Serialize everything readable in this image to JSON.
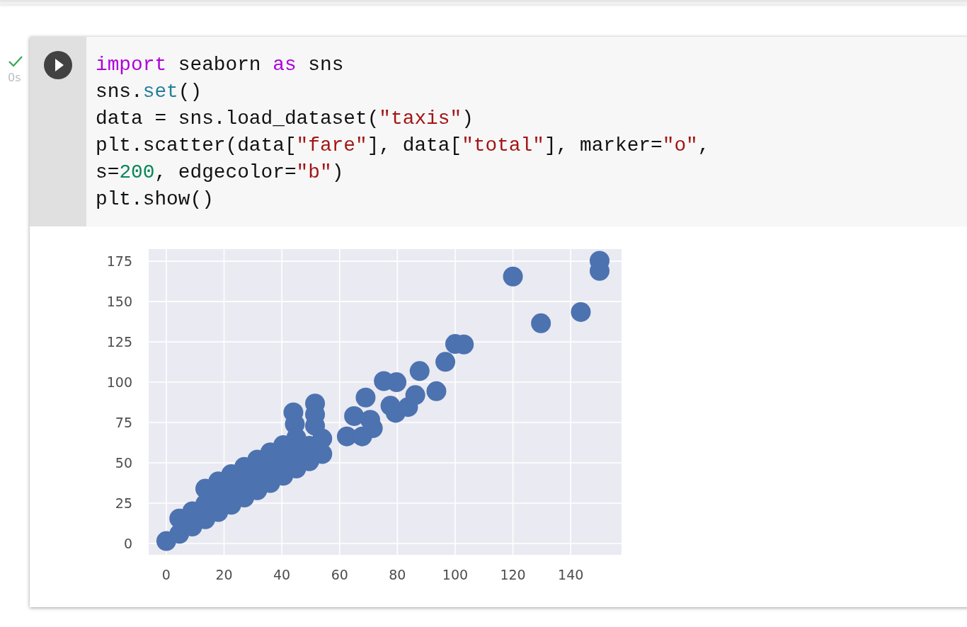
{
  "cell": {
    "executed": true,
    "duration": "0s",
    "code_lines": [
      {
        "tokens": [
          {
            "kind": "keyword",
            "text": "import"
          },
          {
            "kind": "plain",
            "text": " seaborn "
          },
          {
            "kind": "keyword",
            "text": "as"
          },
          {
            "kind": "plain",
            "text": " sns"
          }
        ]
      },
      {
        "tokens": [
          {
            "kind": "plain",
            "text": "sns."
          },
          {
            "kind": "function",
            "text": "set"
          },
          {
            "kind": "plain",
            "text": "()"
          }
        ]
      },
      {
        "tokens": [
          {
            "kind": "plain",
            "text": "data = sns.load_dataset("
          },
          {
            "kind": "string",
            "text": "\"taxis\""
          },
          {
            "kind": "plain",
            "text": ")"
          }
        ]
      },
      {
        "tokens": [
          {
            "kind": "plain",
            "text": "plt.scatter(data["
          },
          {
            "kind": "string",
            "text": "\"fare\""
          },
          {
            "kind": "plain",
            "text": "], data["
          },
          {
            "kind": "string",
            "text": "\"total\""
          },
          {
            "kind": "plain",
            "text": "], marker="
          },
          {
            "kind": "string",
            "text": "\"o\""
          },
          {
            "kind": "plain",
            "text": ","
          }
        ]
      },
      {
        "tokens": [
          {
            "kind": "plain",
            "text": "s="
          },
          {
            "kind": "number",
            "text": "200"
          },
          {
            "kind": "plain",
            "text": ", edgecolor="
          },
          {
            "kind": "string",
            "text": "\"b\""
          },
          {
            "kind": "plain",
            "text": ")"
          }
        ]
      },
      {
        "tokens": [
          {
            "kind": "plain",
            "text": "plt.show()"
          }
        ]
      }
    ],
    "output": {
      "chart_data": {
        "type": "scatter",
        "marker": "o",
        "grid": true,
        "color": "#4c72b0",
        "x": [
          62.5,
          65,
          67.8,
          69,
          70.6,
          71.5,
          75.3,
          79.7,
          77.6,
          79.4,
          83.7,
          86.2,
          87.7,
          93.5,
          96.6,
          100,
          103,
          120,
          129.7,
          143.5,
          150,
          150,
          51.5,
          44,
          51.5,
          44.5,
          51.5,
          13.5,
          18,
          22.5,
          27,
          31.5,
          36,
          40.5,
          45,
          4.5,
          9,
          13.5,
          18,
          22.5,
          27,
          31.5,
          36,
          40.5,
          45,
          49.5,
          54,
          0,
          4.5,
          9,
          13.5,
          18,
          22.5,
          27,
          31.5,
          36,
          40.5,
          45,
          49.5,
          54
        ],
        "values": [
          66.4,
          79,
          66.4,
          90.5,
          76.7,
          71.5,
          100.7,
          100,
          85.4,
          81,
          84.6,
          92,
          106.9,
          94.4,
          112.6,
          123.7,
          123.4,
          165.5,
          136.5,
          143.5,
          175.3,
          169,
          86.8,
          81.3,
          80,
          74,
          73,
          34,
          38.5,
          43,
          47.5,
          52,
          56.5,
          61,
          65.5,
          15.5,
          20,
          24.5,
          29,
          33.5,
          38,
          42.5,
          47,
          51.5,
          56,
          60.5,
          65,
          1.5,
          6,
          10.5,
          15,
          19.5,
          24,
          28.5,
          33,
          37.5,
          42,
          46.5,
          51,
          55.5
        ],
        "xlim": [
          -6.1,
          157.6
        ],
        "ylim": [
          -7,
          182.5
        ],
        "xticks": [
          0,
          20,
          40,
          60,
          80,
          100,
          120,
          140
        ],
        "yticks": [
          0,
          25,
          50,
          75,
          100,
          125,
          150,
          175
        ]
      }
    }
  }
}
